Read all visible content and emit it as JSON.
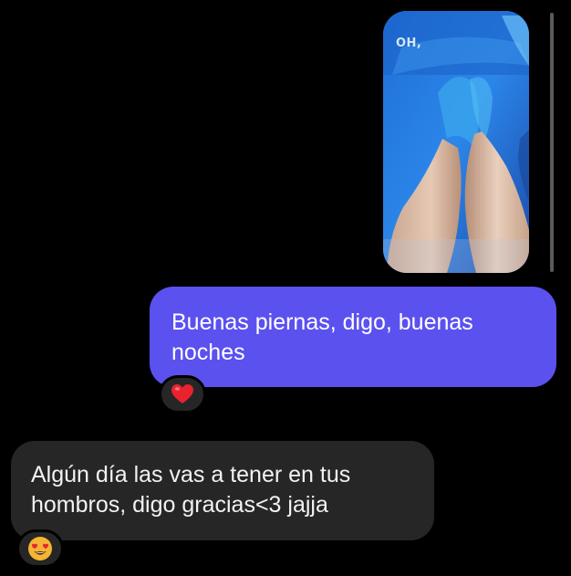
{
  "conversation": {
    "shared_media": {
      "caption": "OH,",
      "image_description_icon": "photo-legs-in-pool"
    },
    "sent_message": {
      "text_line1": "Buenas piernas, digo, buenas",
      "text_line2": "noches",
      "reaction_icon": "red-heart-icon"
    },
    "received_message": {
      "text_line1": "Algún día las vas a tener en tus",
      "text_line2": "hombros, digo gracias<3 jajja",
      "reaction_icon": "heart-eyes-emoji-icon"
    }
  },
  "colors": {
    "background": "#000000",
    "sent_bubble": "#5b51ef",
    "received_bubble": "#262626",
    "reaction_pill": "#262626",
    "heart": "#e8232f",
    "emoji_face": "#f5b433"
  }
}
